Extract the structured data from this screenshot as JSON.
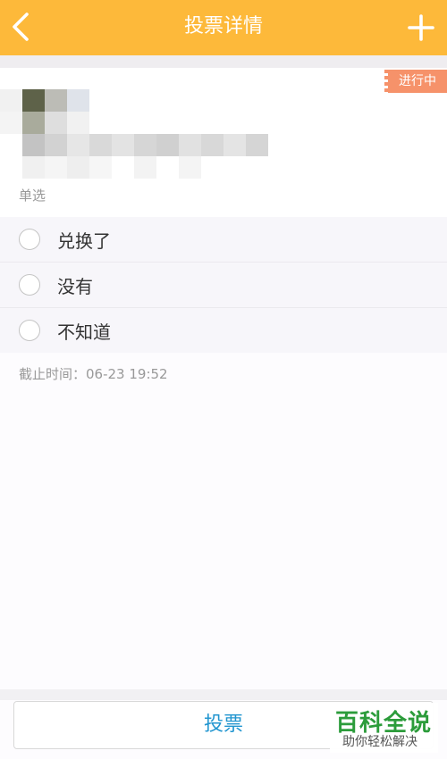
{
  "header": {
    "title": "投票详情",
    "back_icon": "chevron-left-icon",
    "add_icon": "plus-icon"
  },
  "status_badge": "进行中",
  "question_type": "单选",
  "options": [
    {
      "label": "兑换了",
      "selected": false
    },
    {
      "label": "没有",
      "selected": false
    },
    {
      "label": "不知道",
      "selected": false
    }
  ],
  "deadline": "截止时间：06-23 19:52",
  "vote_button": "投票",
  "watermark": {
    "main": "百科全说",
    "sub": "助你轻松解决"
  },
  "colors": {
    "header_bg": "#fdb93a",
    "badge_bg": "#f6926a",
    "vote_text": "#2396d0",
    "watermark_green": "#2c9c3b"
  }
}
